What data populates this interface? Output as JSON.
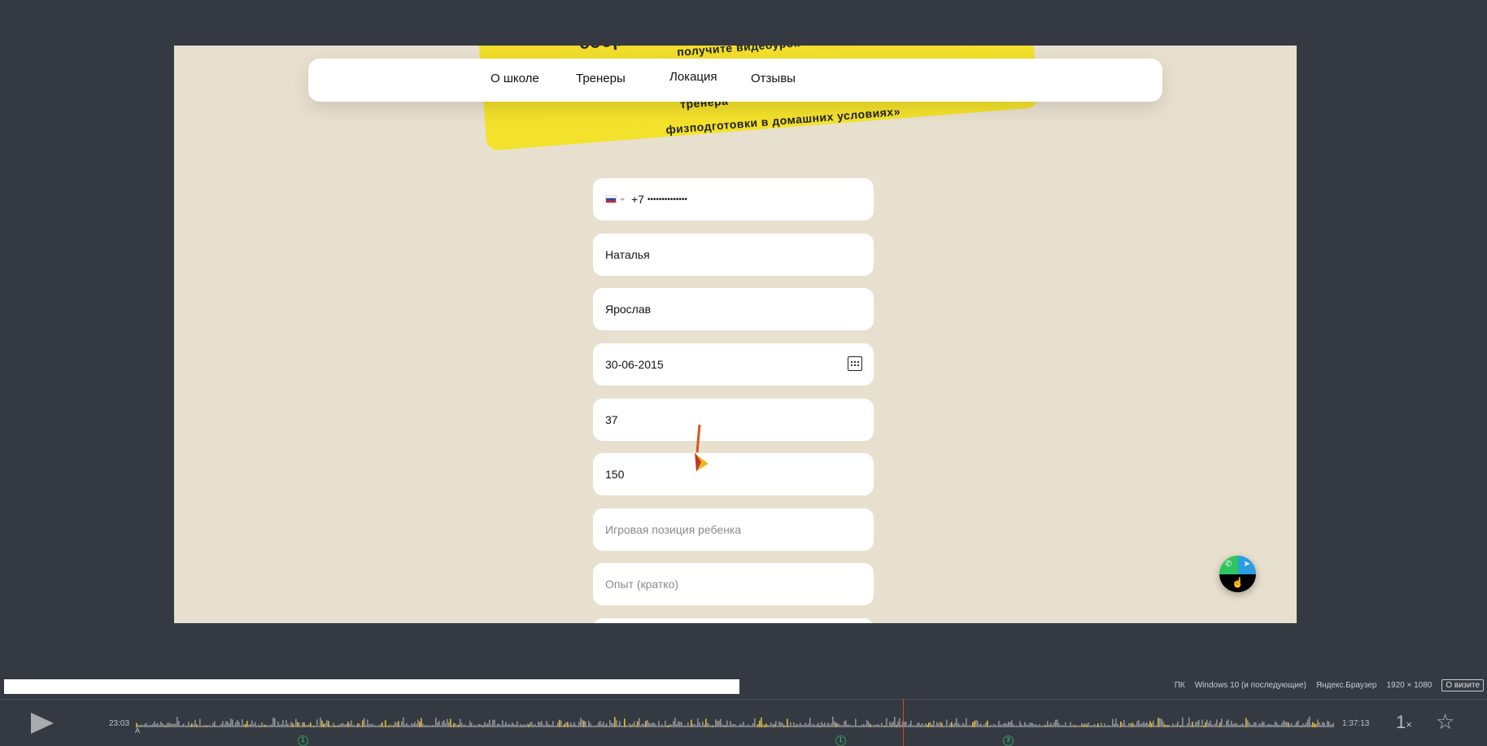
{
  "banner": {
    "line1": "соор",
    "line2": "получите видеоурок",
    "line3": "тренера",
    "line4": "физподготовки в домашних условиях»",
    "color": "#f2dd2a"
  },
  "nav": {
    "items": [
      {
        "label": "О школе"
      },
      {
        "label": "Тренеры"
      },
      {
        "label": "Локация"
      },
      {
        "label": "Отзывы"
      }
    ]
  },
  "form": {
    "phone": {
      "prefix": "+7",
      "value": "••••••••••••••"
    },
    "parent_name": "Наталья",
    "child_name": "Ярослав",
    "birth_date": "30-06-2015",
    "shoe_size": "37",
    "height": "150",
    "position_placeholder": "Игровая позиция ребенка",
    "experience_placeholder": "Опыт (кратко)"
  },
  "fab": {
    "icons": [
      "whatsapp-icon",
      "telegram-icon"
    ]
  },
  "session_info": {
    "device": "ПК",
    "os": "Windows 10 (и последующие)",
    "browser": "Яндекс.Браузер",
    "resolution": "1920 × 1080",
    "visit_button": "О визите"
  },
  "player": {
    "current_time": "23:03",
    "end_time": "1:37:13",
    "speed": "1",
    "speed_suffix": "×",
    "markers": [
      "1",
      "1",
      "3"
    ],
    "start_label": "A"
  }
}
